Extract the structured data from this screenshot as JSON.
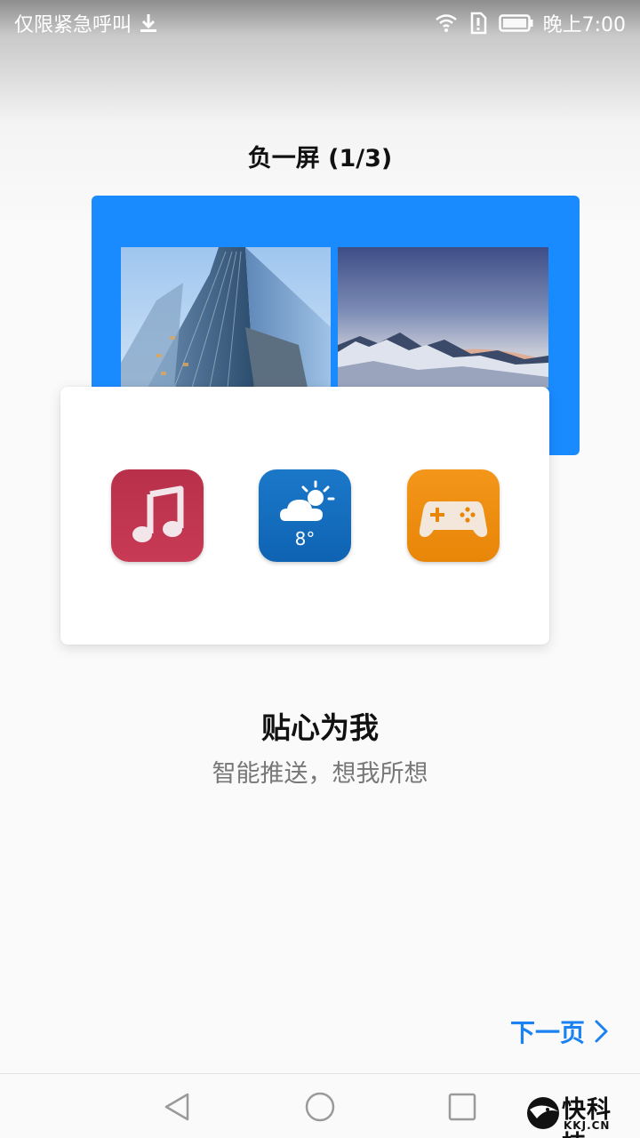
{
  "status_bar": {
    "left_text": "仅限紧急呼叫",
    "time": "晚上7:00",
    "icons": [
      "download-icon",
      "wifi-icon",
      "sim-alert-icon",
      "battery-icon"
    ]
  },
  "page": {
    "title": "负一屏 (1/3)",
    "headline": "贴心为我",
    "subline": "智能推送，想我所想",
    "next_label": "下一页"
  },
  "illustration": {
    "apps": [
      {
        "name": "music-app",
        "icon": "music-note-icon",
        "color": "#c0354f"
      },
      {
        "name": "weather-app",
        "icon": "weather-cloud-sun-icon",
        "label": "8°",
        "color": "#136dbe"
      },
      {
        "name": "game-app",
        "icon": "gamepad-icon",
        "color": "#ee8e10"
      }
    ],
    "accent": "#1a8bff"
  },
  "nav_bar": {
    "buttons": [
      "back-icon",
      "home-icon",
      "recent-apps-icon"
    ]
  },
  "watermark": {
    "text": "快科技",
    "sub": "KKJ.CN"
  }
}
